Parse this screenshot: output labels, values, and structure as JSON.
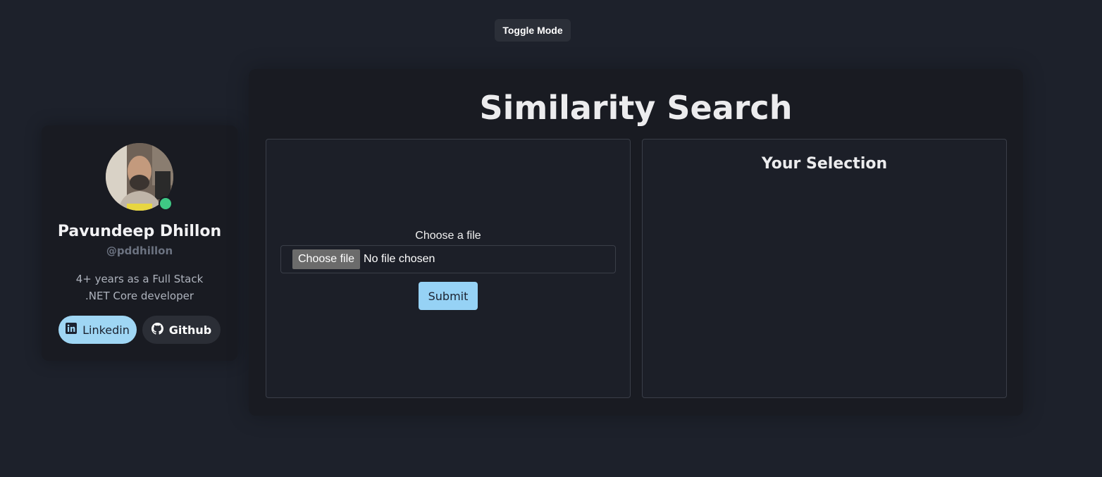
{
  "header": {
    "toggle_label": "Toggle Mode"
  },
  "profile": {
    "name": "Pavundeep Dhillon",
    "handle": "@pddhillon",
    "bio": "4+ years as a Full Stack .NET Core developer",
    "status_color": "#3fc884",
    "links": {
      "linkedin_label": "Linkedin",
      "github_label": "Github"
    }
  },
  "main": {
    "title": "Similarity Search",
    "upload": {
      "label": "Choose a file",
      "button_label": "Choose file",
      "status_text": "No file chosen",
      "submit_label": "Submit"
    },
    "selection": {
      "title": "Your Selection"
    }
  },
  "colors": {
    "background": "#1d212b",
    "card": "#191b22",
    "accent": "#96d2f5",
    "border": "#3a3e48"
  }
}
